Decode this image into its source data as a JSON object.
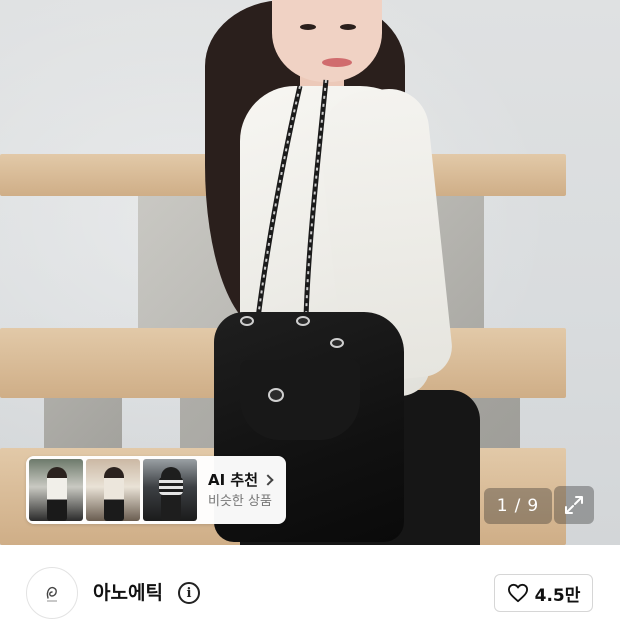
{
  "product_image": {
    "pager": {
      "current": "1",
      "separator": "/",
      "total": "9"
    },
    "fullscreen_icon": "expand-arrows-icon"
  },
  "ai_recommendation": {
    "title": "AI 추천",
    "subtitle": "비슷한 상품",
    "chevron_icon": "chevron-right-icon"
  },
  "brand": {
    "name": "아노에틱",
    "info_icon": "info-icon",
    "info_glyph": "i"
  },
  "like": {
    "icon": "heart-outline-icon",
    "count": "4.5만"
  }
}
